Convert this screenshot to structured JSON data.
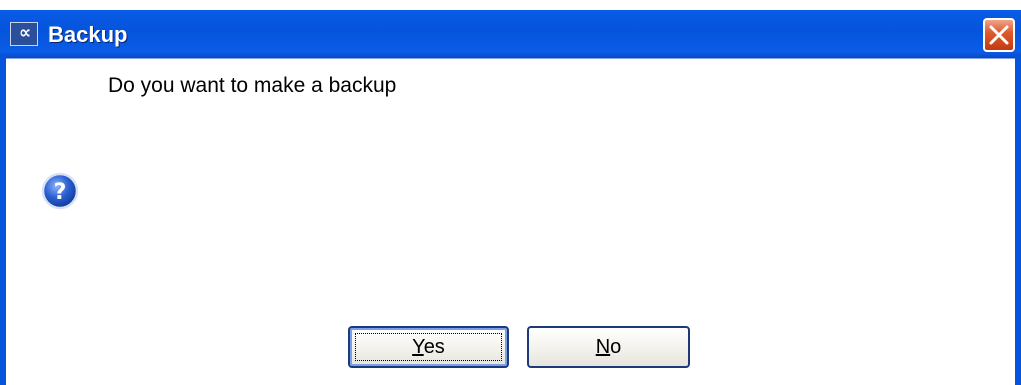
{
  "window": {
    "title": "Backup",
    "app_icon": "app-logo-icon",
    "close_icon": "close-icon"
  },
  "dialog": {
    "message": "Do you want to make a backup",
    "icon": "question-icon"
  },
  "buttons": {
    "yes": {
      "mnemonic": "Y",
      "rest": "es"
    },
    "no": {
      "mnemonic": "N",
      "rest": "o"
    }
  },
  "colors": {
    "titlebar_blue": "#0654dc",
    "close_red": "#e05b2e",
    "question_blue": "#2a5fd0"
  }
}
